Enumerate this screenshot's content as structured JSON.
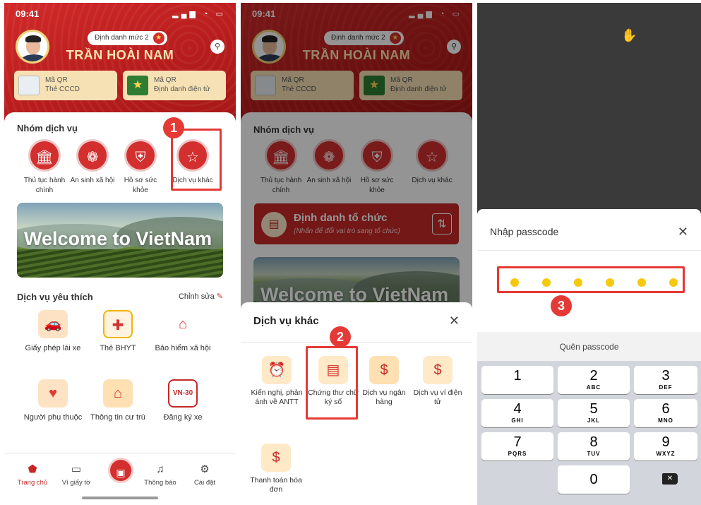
{
  "screen1": {
    "status_time": "09:41",
    "id_level": "Định danh mức 2",
    "user_name": "TRẦN HOÀI NAM",
    "qr_cards": [
      {
        "line1": "Mã QR",
        "line2": "Thẻ CCCD"
      },
      {
        "line1": "Mã QR",
        "line2": "Định danh điện tử"
      }
    ],
    "services_title": "Nhóm dịch vụ",
    "services": [
      {
        "label": "Thủ tục hành chính",
        "icon": "bank-icon"
      },
      {
        "label": "An sinh xã hội",
        "icon": "flower-icon"
      },
      {
        "label": "Hồ sơ sức khỏe",
        "icon": "shield-icon"
      },
      {
        "label": "Dịch vụ khác",
        "icon": "star-icon"
      }
    ],
    "banner_text": "Welcome to VietNam",
    "favorites_title": "Dịch vụ yêu thích",
    "edit_label": "Chỉnh sửa",
    "favorites": [
      {
        "label": "Giấy phép lái xe",
        "icon": "car-icon"
      },
      {
        "label": "Thẻ BHYT",
        "icon": "health-shield-icon"
      },
      {
        "label": "Bảo hiểm xã hội",
        "icon": "house-heart-icon"
      },
      {
        "label": "Người phụ thuộc",
        "icon": "hands-heart-icon"
      },
      {
        "label": "Thông tin cư trú",
        "icon": "residence-icon"
      },
      {
        "label": "Đăng ký xe",
        "icon": "license-plate-icon"
      }
    ],
    "plate_text": "VN-30",
    "tabs": [
      "Trang chủ",
      "Ví giấy tờ",
      "Thông báo",
      "Cài đặt"
    ],
    "step": "1"
  },
  "screen2": {
    "status_time": "09:41",
    "id_level": "Định danh mức 2",
    "user_name": "TRẦN HOÀI NAM",
    "qr_cards": [
      {
        "line1": "Mã QR",
        "line2": "Thẻ CCCD"
      },
      {
        "line1": "Mã QR",
        "line2": "Định danh điện tử"
      }
    ],
    "services_title": "Nhóm dịch vụ",
    "services": [
      {
        "label": "Thủ tục hành chính"
      },
      {
        "label": "An sinh xã hội"
      },
      {
        "label": "Hồ sơ sức khỏe"
      },
      {
        "label": "Dịch vụ khác"
      }
    ],
    "org_title": "Định danh tổ chức",
    "org_sub": "(Nhấn để đổi vai trò sang tổ chức)",
    "banner_text": "Welcome to VietNam",
    "sheet_title": "Dịch vụ khác",
    "sheet_items": [
      {
        "label": "Kiến nghị, phản ánh về ANTT",
        "icon": "alarm-icon"
      },
      {
        "label": "Chứng thư chữ ký số",
        "icon": "certificate-icon"
      },
      {
        "label": "Dịch vụ ngân hàng",
        "icon": "bank-icon"
      },
      {
        "label": "Dịch vụ ví điện tử",
        "icon": "wallet-icon"
      },
      {
        "label": "Thanh toán hóa đơn",
        "icon": "bill-icon"
      }
    ],
    "step": "2"
  },
  "screen3": {
    "passcode_title": "Nhập passcode",
    "forgot": "Quên passcode",
    "dots_filled": 6,
    "keys": [
      {
        "n": "1",
        "l": ""
      },
      {
        "n": "2",
        "l": "ABC"
      },
      {
        "n": "3",
        "l": "DEF"
      },
      {
        "n": "4",
        "l": "GHI"
      },
      {
        "n": "5",
        "l": "JKL"
      },
      {
        "n": "6",
        "l": "MNO"
      },
      {
        "n": "7",
        "l": "PQRS"
      },
      {
        "n": "8",
        "l": "TUV"
      },
      {
        "n": "9",
        "l": "WXYZ"
      },
      {
        "n": "0",
        "l": ""
      }
    ],
    "step": "3"
  },
  "colors": {
    "brand_red": "#c41f25",
    "highlight": "#e53935",
    "passcode_dot": "#f6c90e"
  }
}
